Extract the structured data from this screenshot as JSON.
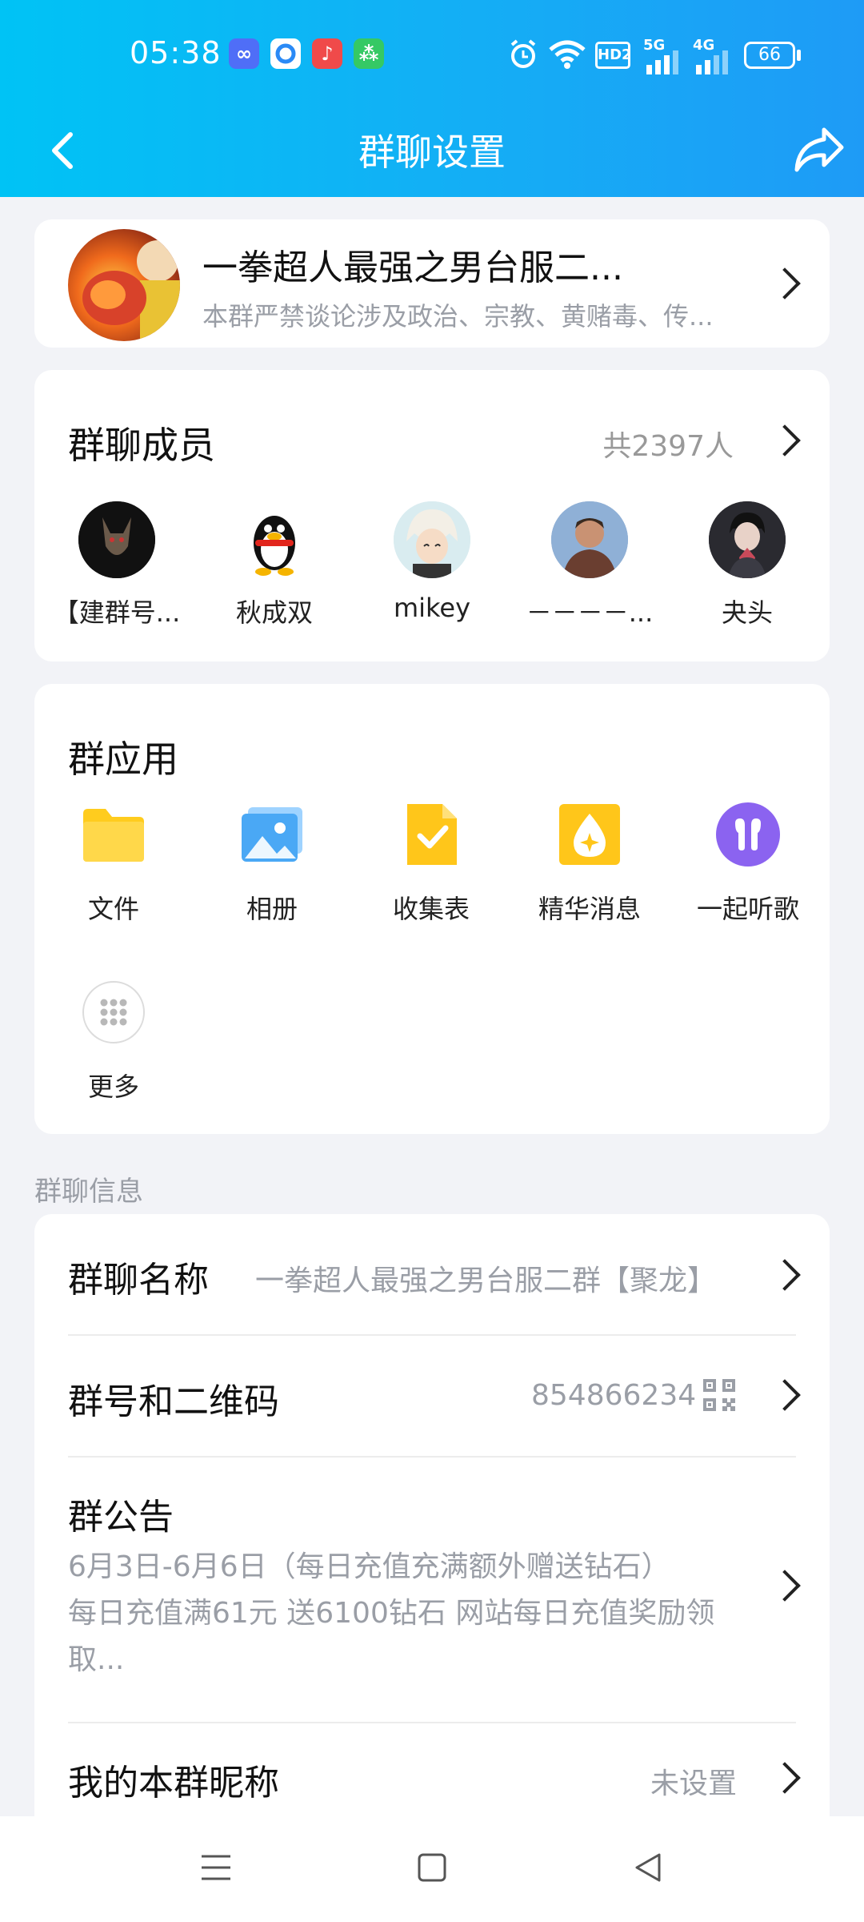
{
  "status_bar": {
    "time": "05:38",
    "network_badges": [
      "HD2",
      "5G",
      "4G"
    ],
    "battery": "66"
  },
  "header": {
    "title": "群聊设置",
    "back_icon": "chevron-left-icon",
    "share_icon": "share-arrow-icon"
  },
  "group": {
    "name": "一拳超人最强之男台服二...",
    "description": "本群严禁谈论涉及政治、宗教、黄赌毒、传..."
  },
  "members": {
    "title": "群聊成员",
    "count": "共2397人",
    "items": [
      {
        "name": "【建群号..."
      },
      {
        "name": "秋成双"
      },
      {
        "name": "mikey"
      },
      {
        "name": "－－－－..."
      },
      {
        "name": "夬头"
      }
    ]
  },
  "apps": {
    "title": "群应用",
    "items": [
      {
        "label": "文件",
        "icon": "folder-icon"
      },
      {
        "label": "相册",
        "icon": "photo-album-icon"
      },
      {
        "label": "收集表",
        "icon": "form-check-icon"
      },
      {
        "label": "精华消息",
        "icon": "essence-drop-icon"
      },
      {
        "label": "一起听歌",
        "icon": "earbuds-icon"
      },
      {
        "label": "更多",
        "icon": "more-grid-icon"
      }
    ]
  },
  "info": {
    "section_label": "群聊信息",
    "name_label": "群聊名称",
    "name_value": "一拳超人最强之男台服二群【聚龙】",
    "number_label": "群号和二维码",
    "number_value": "854866234",
    "notice_label": "群公告",
    "notice_line1": "6月3日-6月6日（每日充值充满额外赠送钻石）",
    "notice_line2": "每日充值满61元 送6100钻石 网站每日充值奖励领",
    "notice_line3": "取...",
    "nickname_label": "我的本群昵称",
    "nickname_value": "未设置"
  },
  "colors": {
    "header_start": "#00c3f5",
    "header_end": "#1e9bf6",
    "background": "#f2f3f7",
    "secondary_text": "#9a9ea6"
  }
}
